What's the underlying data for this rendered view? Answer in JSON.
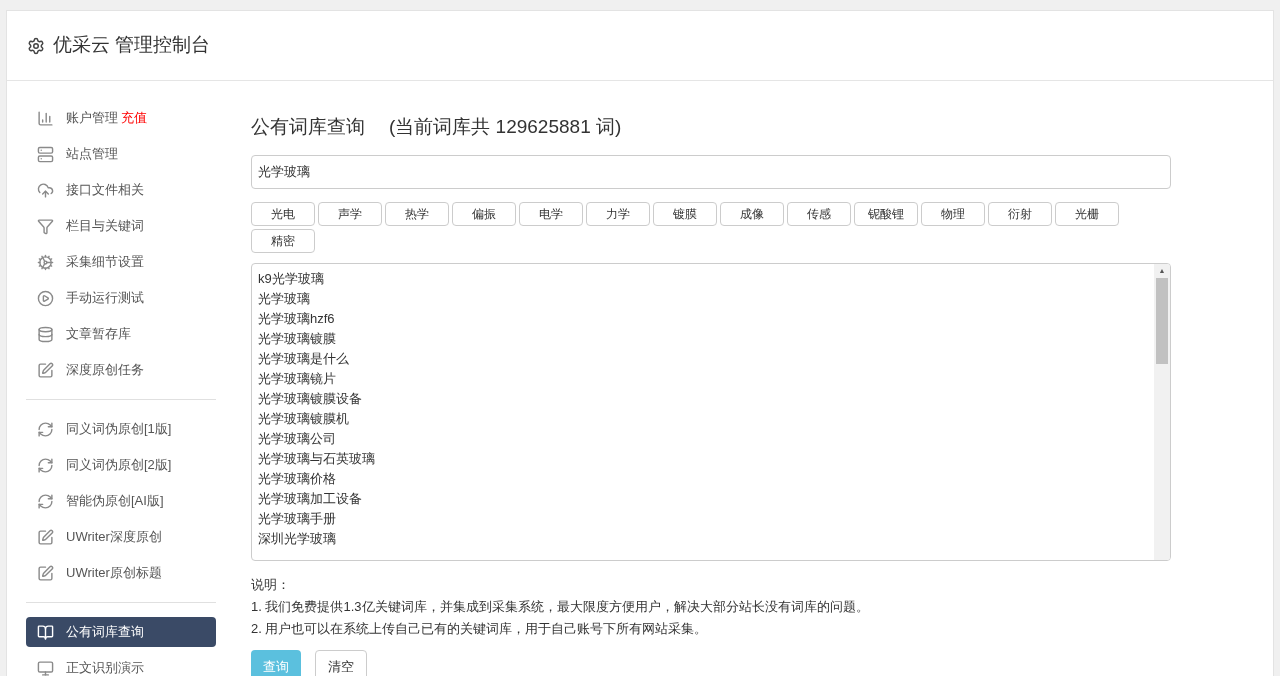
{
  "header": {
    "title": "优采云 管理控制台"
  },
  "sidebar": {
    "groups": [
      {
        "items": [
          {
            "label": "账户管理",
            "badge": "充值",
            "selected": false
          },
          {
            "label": "站点管理",
            "selected": false
          },
          {
            "label": "接口文件相关",
            "selected": false
          },
          {
            "label": "栏目与关键词",
            "selected": false
          },
          {
            "label": "采集细节设置",
            "selected": false
          },
          {
            "label": "手动运行测试",
            "selected": false
          },
          {
            "label": "文章暂存库",
            "selected": false
          },
          {
            "label": "深度原创任务",
            "selected": false
          }
        ]
      },
      {
        "items": [
          {
            "label": "同义词伪原创[1版]",
            "selected": false
          },
          {
            "label": "同义词伪原创[2版]",
            "selected": false
          },
          {
            "label": "智能伪原创[AI版]",
            "selected": false
          },
          {
            "label": "UWriter深度原创",
            "selected": false
          },
          {
            "label": "UWriter原创标题",
            "selected": false
          }
        ]
      },
      {
        "items": [
          {
            "label": "公有词库查询",
            "selected": true
          },
          {
            "label": "正文识别演示",
            "selected": false
          }
        ]
      }
    ]
  },
  "scroll_arrow": "▲",
  "main": {
    "title": "公有词库查询",
    "subtitle": "(当前词库共 129625881 词)",
    "search": {
      "value": "光学玻璃"
    },
    "tags": [
      "光电",
      "声学",
      "热学",
      "偏振",
      "电学",
      "力学",
      "镀膜",
      "成像",
      "传感",
      "铌酸锂",
      "物理",
      "衍射",
      "光栅",
      "精密"
    ],
    "results": [
      "k9光学玻璃",
      "光学玻璃",
      "光学玻璃hzf6",
      "光学玻璃镀膜",
      "光学玻璃是什么",
      "光学玻璃镜片",
      "光学玻璃镀膜设备",
      "光学玻璃镀膜机",
      "光学玻璃公司",
      "光学玻璃与石英玻璃",
      "光学玻璃价格",
      "光学玻璃加工设备",
      "光学玻璃手册",
      "深圳光学玻璃"
    ],
    "notes_title": "说明：",
    "notes": [
      "1. 我们免费提供1.3亿关键词库，并集成到采集系统，最大限度方便用户，解决大部分站长没有词库的问题。",
      "2. 用户也可以在系统上传自己已有的关键词库，用于自己账号下所有网站采集。"
    ],
    "buttons": [
      {
        "kind": "primary",
        "label": "查询"
      },
      {
        "kind": "default",
        "label": "清空"
      }
    ]
  }
}
